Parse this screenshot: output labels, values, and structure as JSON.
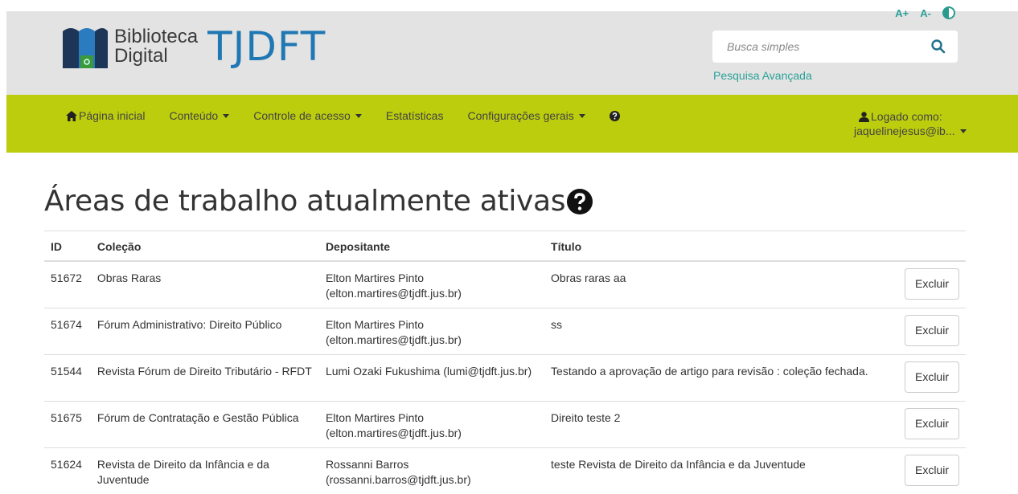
{
  "header": {
    "logo_line1": "Biblioteca",
    "logo_line2": "Digital",
    "logo_brand": "TJDFT",
    "font_increase": "A+",
    "font_decrease": "A-",
    "contrast_icon": "contrast-icon",
    "search": {
      "placeholder": "Busca simples",
      "value": ""
    },
    "advanced_search": "Pesquisa Avançada"
  },
  "nav": {
    "home": "Página inicial",
    "content": "Conteúdo",
    "access_control": "Controle de acesso",
    "statistics": "Estatísticas",
    "settings": "Configurações gerais",
    "user_label": "Logado como:",
    "user_name": "jaquelinejesus@ib..."
  },
  "page": {
    "title": "Áreas de trabalho atualmente ativas"
  },
  "table": {
    "headers": {
      "id": "ID",
      "collection": "Coleção",
      "depositor": "Depositante",
      "title": "Título"
    },
    "rows": [
      {
        "id": "51672",
        "collection": "Obras Raras",
        "depositor_name": "Elton Martires Pinto",
        "depositor_email": "(elton.martires@tjdft.jus.br)",
        "title": "Obras raras aa",
        "action": "Excluir"
      },
      {
        "id": "51674",
        "collection": "Fórum Administrativo: Direito Público",
        "depositor_name": "Elton Martires Pinto",
        "depositor_email": "(elton.martires@tjdft.jus.br)",
        "title": "ss",
        "action": "Excluir"
      },
      {
        "id": "51544",
        "collection": "Revista Fórum de Direito Tributário - RFDT",
        "depositor_name": "Lumi Ozaki Fukushima (lumi@tjdft.jus.br)",
        "depositor_email": "",
        "title": "Testando a aprovação de artigo para revisão : coleção fechada.",
        "action": "Excluir"
      },
      {
        "id": "51675",
        "collection": "Fórum de Contratação e Gestão Pública",
        "depositor_name": "Elton Martires Pinto",
        "depositor_email": "(elton.martires@tjdft.jus.br)",
        "title": "Direito teste 2",
        "action": "Excluir"
      },
      {
        "id": "51624",
        "collection": "Revista de Direito da Infância e da Juventude",
        "depositor_name": "Rossanni Barros",
        "depositor_email": "(rossanni.barros@tjdft.jus.br)",
        "title": "teste Revista de Direito da Infância e da Juventude",
        "action": "Excluir"
      }
    ]
  },
  "colors": {
    "navbar": "#bccd0d",
    "header_bg": "#e3e3e3",
    "brand_blue": "#1f78b4",
    "link_teal": "#2aa198"
  }
}
